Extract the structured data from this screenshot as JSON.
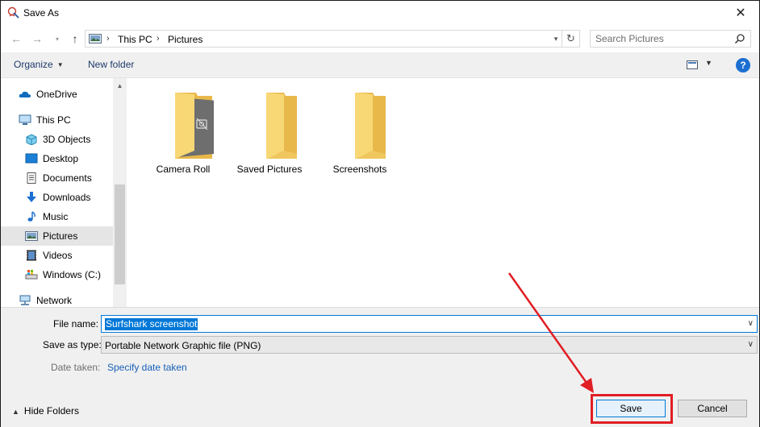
{
  "window": {
    "title": "Save As"
  },
  "address": {
    "crumbs": [
      "This PC",
      "Pictures"
    ]
  },
  "search": {
    "placeholder": "Search Pictures"
  },
  "toolbar": {
    "organize_label": "Organize",
    "new_folder_label": "New folder",
    "help_label": "?"
  },
  "sidebar": {
    "items": [
      {
        "label": "OneDrive",
        "icon": "onedrive-icon"
      },
      {
        "label": "This PC",
        "icon": "this-pc-icon"
      },
      {
        "label": "3D Objects",
        "icon": "3d-objects-icon"
      },
      {
        "label": "Desktop",
        "icon": "desktop-icon"
      },
      {
        "label": "Documents",
        "icon": "documents-icon"
      },
      {
        "label": "Downloads",
        "icon": "downloads-icon"
      },
      {
        "label": "Music",
        "icon": "music-icon"
      },
      {
        "label": "Pictures",
        "icon": "pictures-icon",
        "selected": true
      },
      {
        "label": "Videos",
        "icon": "videos-icon"
      },
      {
        "label": "Windows (C:)",
        "icon": "drive-icon"
      },
      {
        "label": "Network",
        "icon": "network-icon"
      }
    ]
  },
  "folders": [
    {
      "name": "Camera Roll",
      "icon": "camera-roll-folder-icon"
    },
    {
      "name": "Saved Pictures",
      "icon": "folder-icon"
    },
    {
      "name": "Screenshots",
      "icon": "folder-icon"
    }
  ],
  "form": {
    "file_name_label": "File name:",
    "file_name_value": "Surfshark screenshot",
    "save_type_label": "Save as type:",
    "save_type_value": "Portable Network Graphic file (PNG)",
    "date_taken_label": "Date taken:",
    "date_taken_link": "Specify date taken"
  },
  "footer": {
    "hide_folders_label": "Hide Folders",
    "save_label": "Save",
    "cancel_label": "Cancel"
  },
  "colors": {
    "accent": "#0078d7",
    "folder": "#f8d775",
    "annotation": "#e01e24",
    "link": "#1560b8"
  }
}
